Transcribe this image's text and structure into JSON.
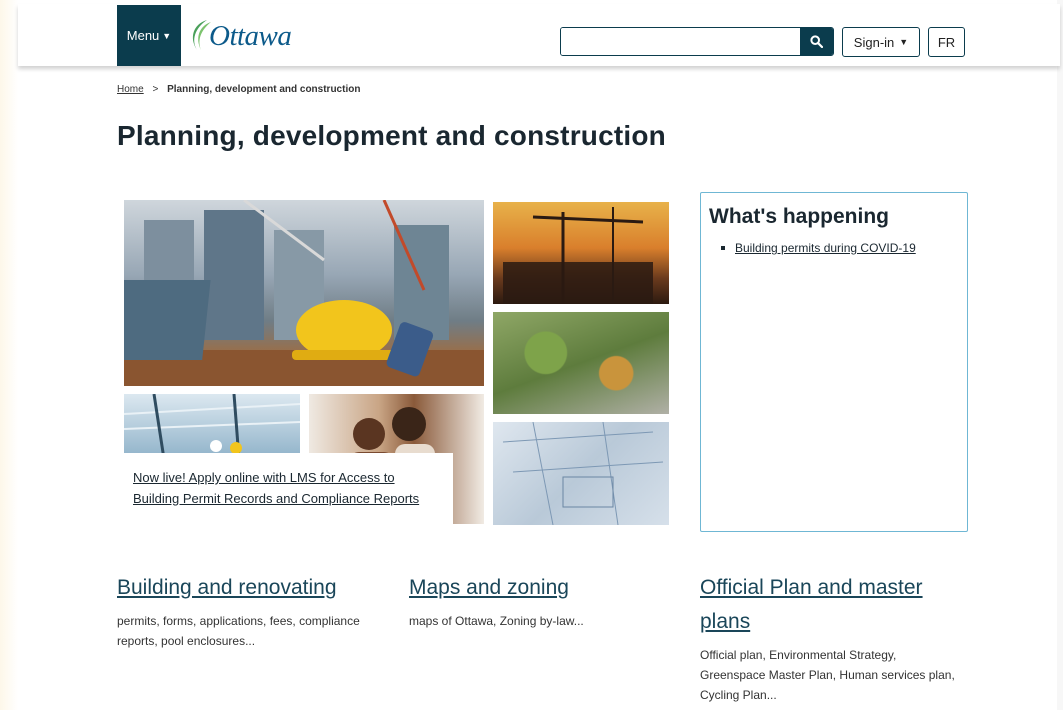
{
  "header": {
    "menu_label": "Menu",
    "logo_text": "Ottawa",
    "search": {
      "value": "",
      "placeholder": ""
    },
    "signin_label": "Sign-in",
    "lang_label": "FR"
  },
  "breadcrumb": {
    "home": "Home",
    "separator": ">",
    "current": "Planning, development and construction"
  },
  "page_title": "Planning, development and construction",
  "feature": {
    "link_line1": "Now live! Apply online with LMS for Access to",
    "link_line2": "Building Permit Records and Compliance Reports"
  },
  "whats_happening": {
    "title": "What's happening",
    "items": [
      {
        "label": "Building permits during COVID-19"
      }
    ]
  },
  "categories": [
    {
      "title": "Building and renovating",
      "description": "permits, forms, applications, fees, compliance reports, pool enclosures..."
    },
    {
      "title": "Maps and zoning",
      "description": "maps of Ottawa, Zoning by-law..."
    },
    {
      "title": "Official Plan and master plans",
      "description": "Official plan, Environmental Strategy, Greenspace Master Plan, Human services plan, Cycling Plan..."
    }
  ],
  "colors": {
    "brand_dark": "#0b3c4d",
    "accent_border": "#6fb7d4",
    "logo_green": "#4aa05a",
    "logo_blue": "#0c5a8a"
  },
  "icons": [
    "menu-caret-icon",
    "ottawa-logo-icon",
    "search-icon",
    "signin-caret-icon",
    "bullet-icon"
  ]
}
